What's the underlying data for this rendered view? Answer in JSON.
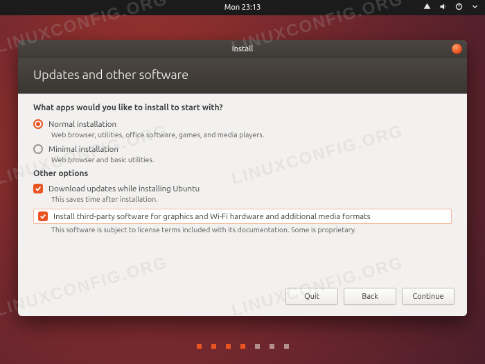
{
  "panel": {
    "clock": "Mon 23:13"
  },
  "window": {
    "title": "Install",
    "header": "Updates and other software"
  },
  "content": {
    "question": "What apps would you like to install to start with?",
    "normal_label": "Normal installation",
    "normal_sub": "Web browser, utilities, office software, games, and media players.",
    "minimal_label": "Minimal installation",
    "minimal_sub": "Web browser and basic utilities.",
    "other_title": "Other options",
    "download_label": "Download updates while installing Ubuntu",
    "download_sub": "This saves time after installation.",
    "thirdparty_label": "Install third-party software for graphics and Wi-Fi hardware and additional media formats",
    "thirdparty_sub": "This software is subject to license terms included with its documentation. Some is proprietary."
  },
  "buttons": {
    "quit": "Quit",
    "back": "Back",
    "continue": "Continue"
  },
  "watermark": "LINUXCONFIG.ORG",
  "steps": {
    "total": 7,
    "current": 4
  },
  "colors": {
    "accent": "#e95420"
  }
}
